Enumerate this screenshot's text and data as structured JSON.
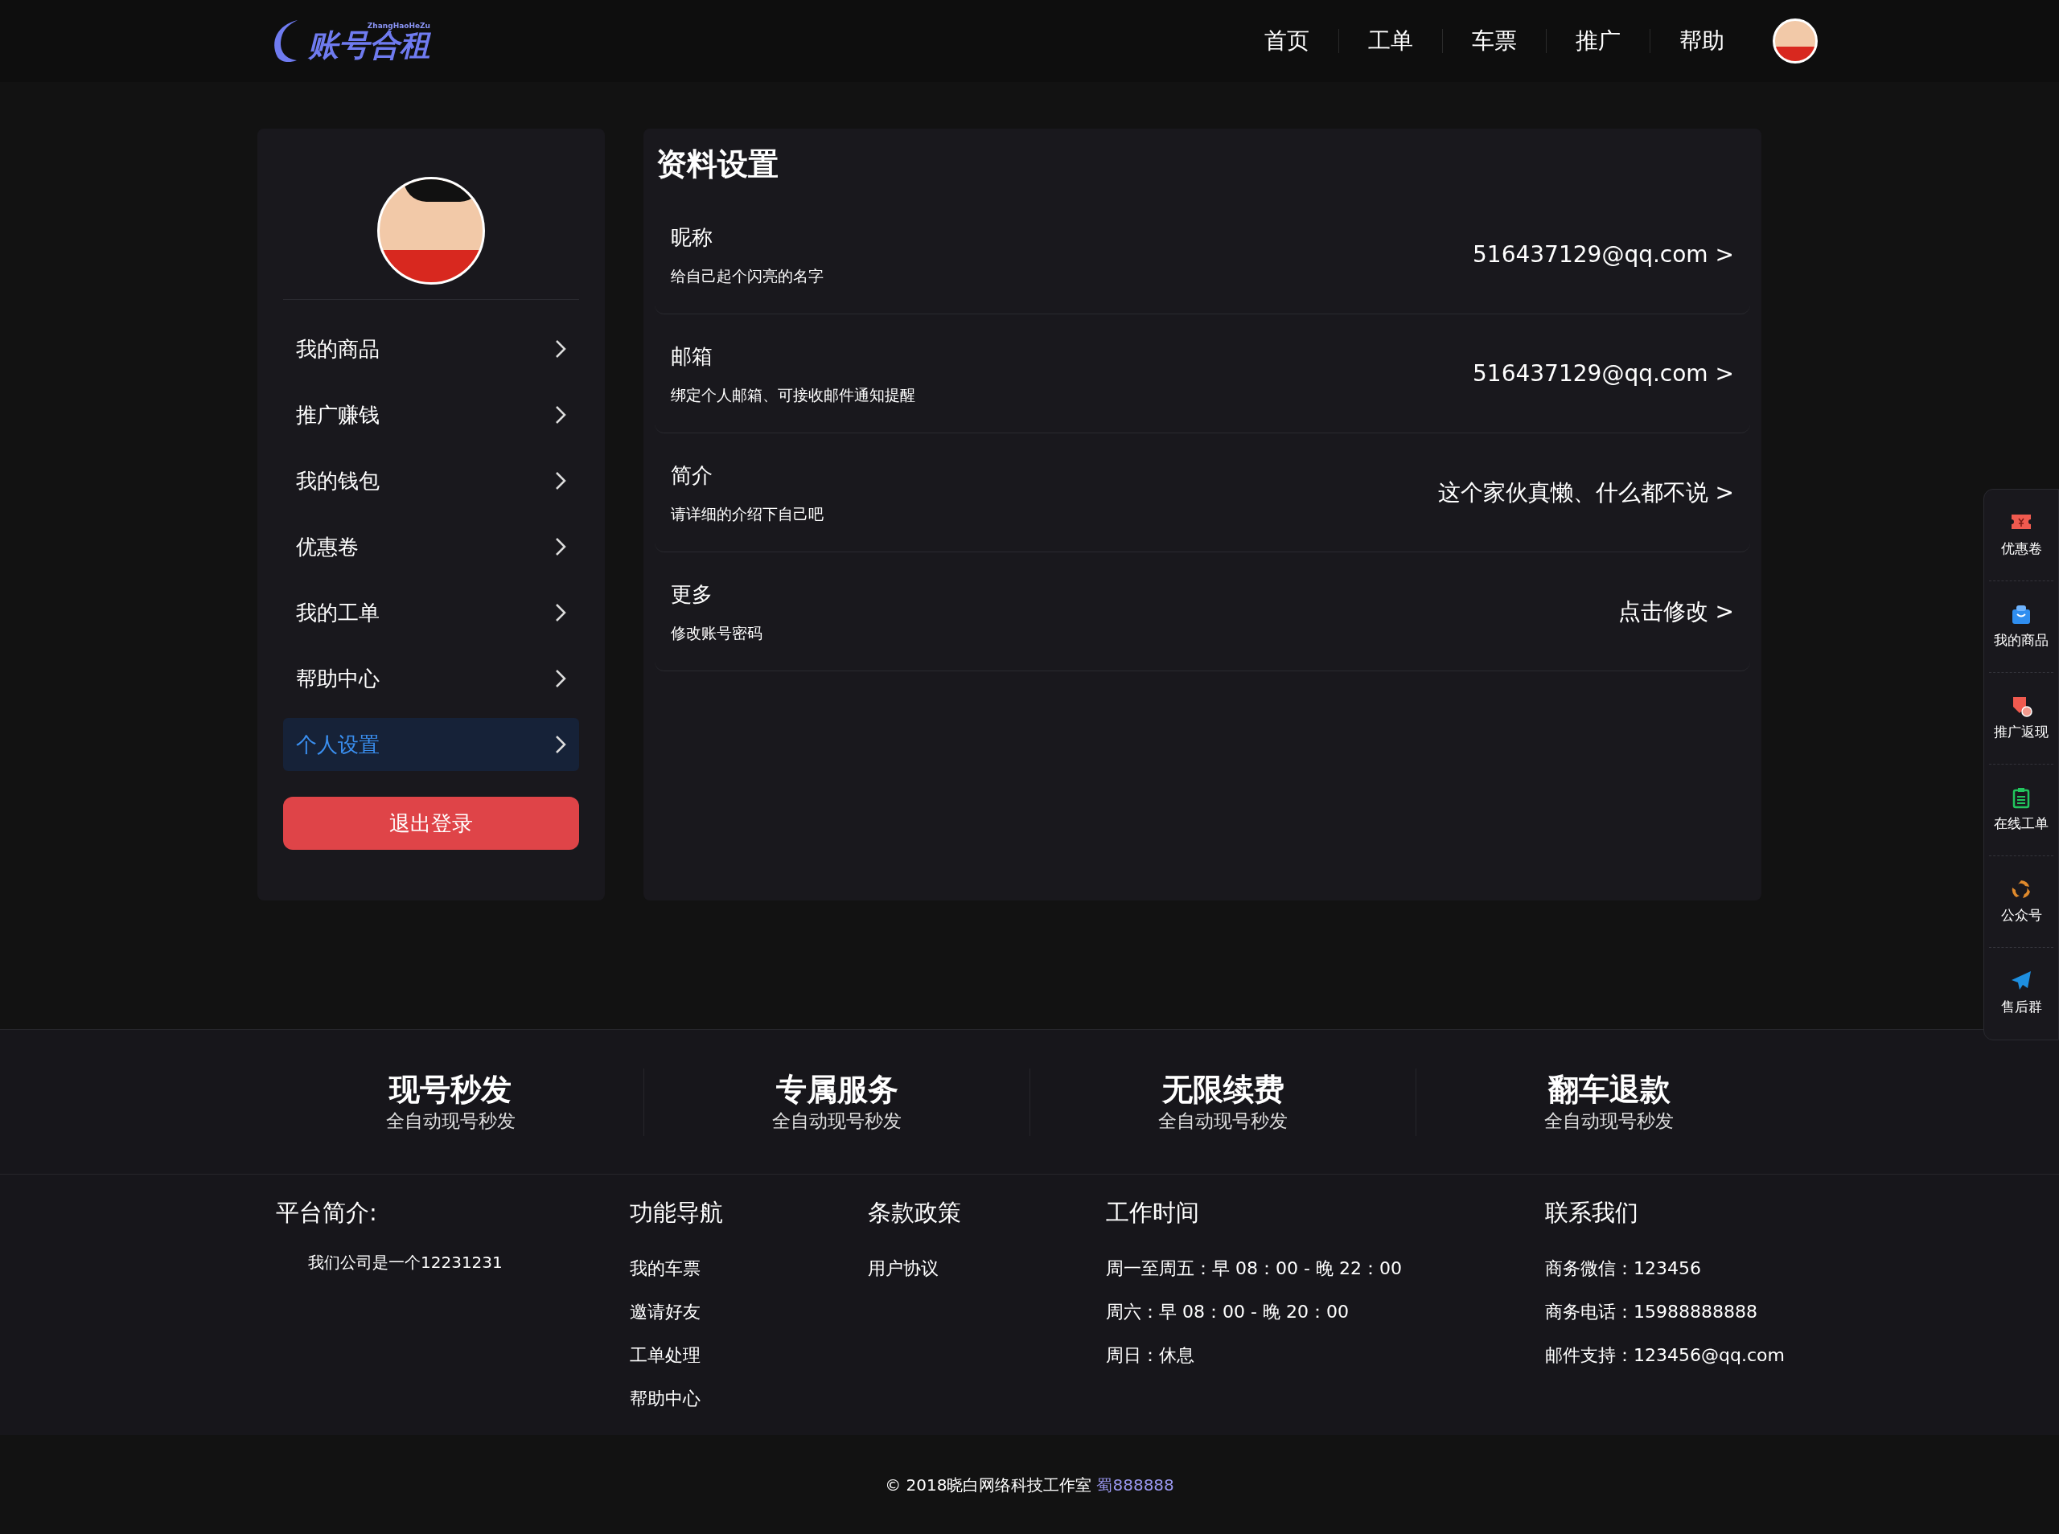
{
  "header": {
    "logo": {
      "text": "账号合租",
      "subtext": "ZhangHaoHeZu"
    },
    "nav": [
      {
        "label": "首页"
      },
      {
        "label": "工单"
      },
      {
        "label": "车票"
      },
      {
        "label": "推广"
      },
      {
        "label": "帮助"
      }
    ]
  },
  "sidebar": {
    "items": [
      {
        "label": "我的商品",
        "selected": false
      },
      {
        "label": "推广赚钱",
        "selected": false
      },
      {
        "label": "我的钱包",
        "selected": false
      },
      {
        "label": "优惠卷",
        "selected": false
      },
      {
        "label": "我的工单",
        "selected": false
      },
      {
        "label": "帮助中心",
        "selected": false
      },
      {
        "label": "个人设置",
        "selected": true
      }
    ],
    "logout": "退出登录"
  },
  "profile": {
    "title": "资料设置",
    "rows": [
      {
        "label": "昵称",
        "hint": "给自己起个闪亮的名字",
        "value": "516437129@qq.com >"
      },
      {
        "label": "邮箱",
        "hint": "绑定个人邮箱、可接收邮件通知提醒",
        "value": "516437129@qq.com >"
      },
      {
        "label": "简介",
        "hint": "请详细的介绍下自己吧",
        "value": "这个家伙真懒、什么都不说 >"
      },
      {
        "label": "更多",
        "hint": "修改账号密码",
        "value": "点击修改 >"
      }
    ]
  },
  "float_bar": [
    {
      "kind": "ticket",
      "label": "优惠卷"
    },
    {
      "kind": "bag",
      "label": "我的商品"
    },
    {
      "kind": "refund",
      "label": "推广返现"
    },
    {
      "kind": "clipboard",
      "label": "在线工单"
    },
    {
      "kind": "swirl",
      "label": "公众号"
    },
    {
      "kind": "plane",
      "label": "售后群"
    }
  ],
  "features": [
    {
      "title": "现号秒发",
      "subtitle": "全自动现号秒发"
    },
    {
      "title": "专属服务",
      "subtitle": "全自动现号秒发"
    },
    {
      "title": "无限续费",
      "subtitle": "全自动现号秒发"
    },
    {
      "title": "翻车退款",
      "subtitle": "全自动现号秒发"
    }
  ],
  "footer": {
    "about": {
      "heading": "平台简介:",
      "text": "我们公司是一个12231231"
    },
    "columns": [
      {
        "heading": "功能导航",
        "items": [
          "我的车票",
          "邀请好友",
          "工单处理",
          "帮助中心"
        ]
      },
      {
        "heading": "条款政策",
        "items": [
          "用户协议"
        ]
      },
      {
        "heading": "工作时间",
        "items": [
          "周一至周五：早 08：00 - 晚 22：00",
          "周六：早 08：00 - 晚 20：00",
          "周日：休息"
        ]
      },
      {
        "heading": "联系我们",
        "items": [
          "商务微信：123456",
          "商务电话：15988888888",
          "邮件支持：123456@qq.com"
        ]
      }
    ]
  },
  "copyright": {
    "text": "© 2018晓白网络科技工作室",
    "icp": "蜀888888"
  }
}
